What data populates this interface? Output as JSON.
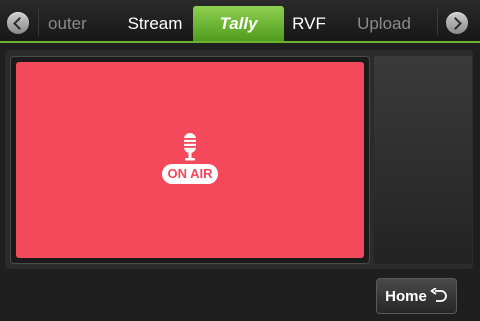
{
  "tabs": [
    {
      "label": "outer",
      "active": false,
      "dim": true
    },
    {
      "label": "Stream",
      "active": false,
      "dim": false
    },
    {
      "label": "Tally",
      "active": true,
      "dim": false
    },
    {
      "label": "RVF",
      "active": false,
      "dim": false
    },
    {
      "label": "Upload",
      "active": false,
      "dim": true
    }
  ],
  "tally": {
    "status_text": "ON AIR",
    "color": "#f4485b",
    "icon": "microphone-icon"
  },
  "accent_color": "#6ab22f",
  "home": {
    "label": "Home",
    "icon": "return-arrow-icon"
  }
}
